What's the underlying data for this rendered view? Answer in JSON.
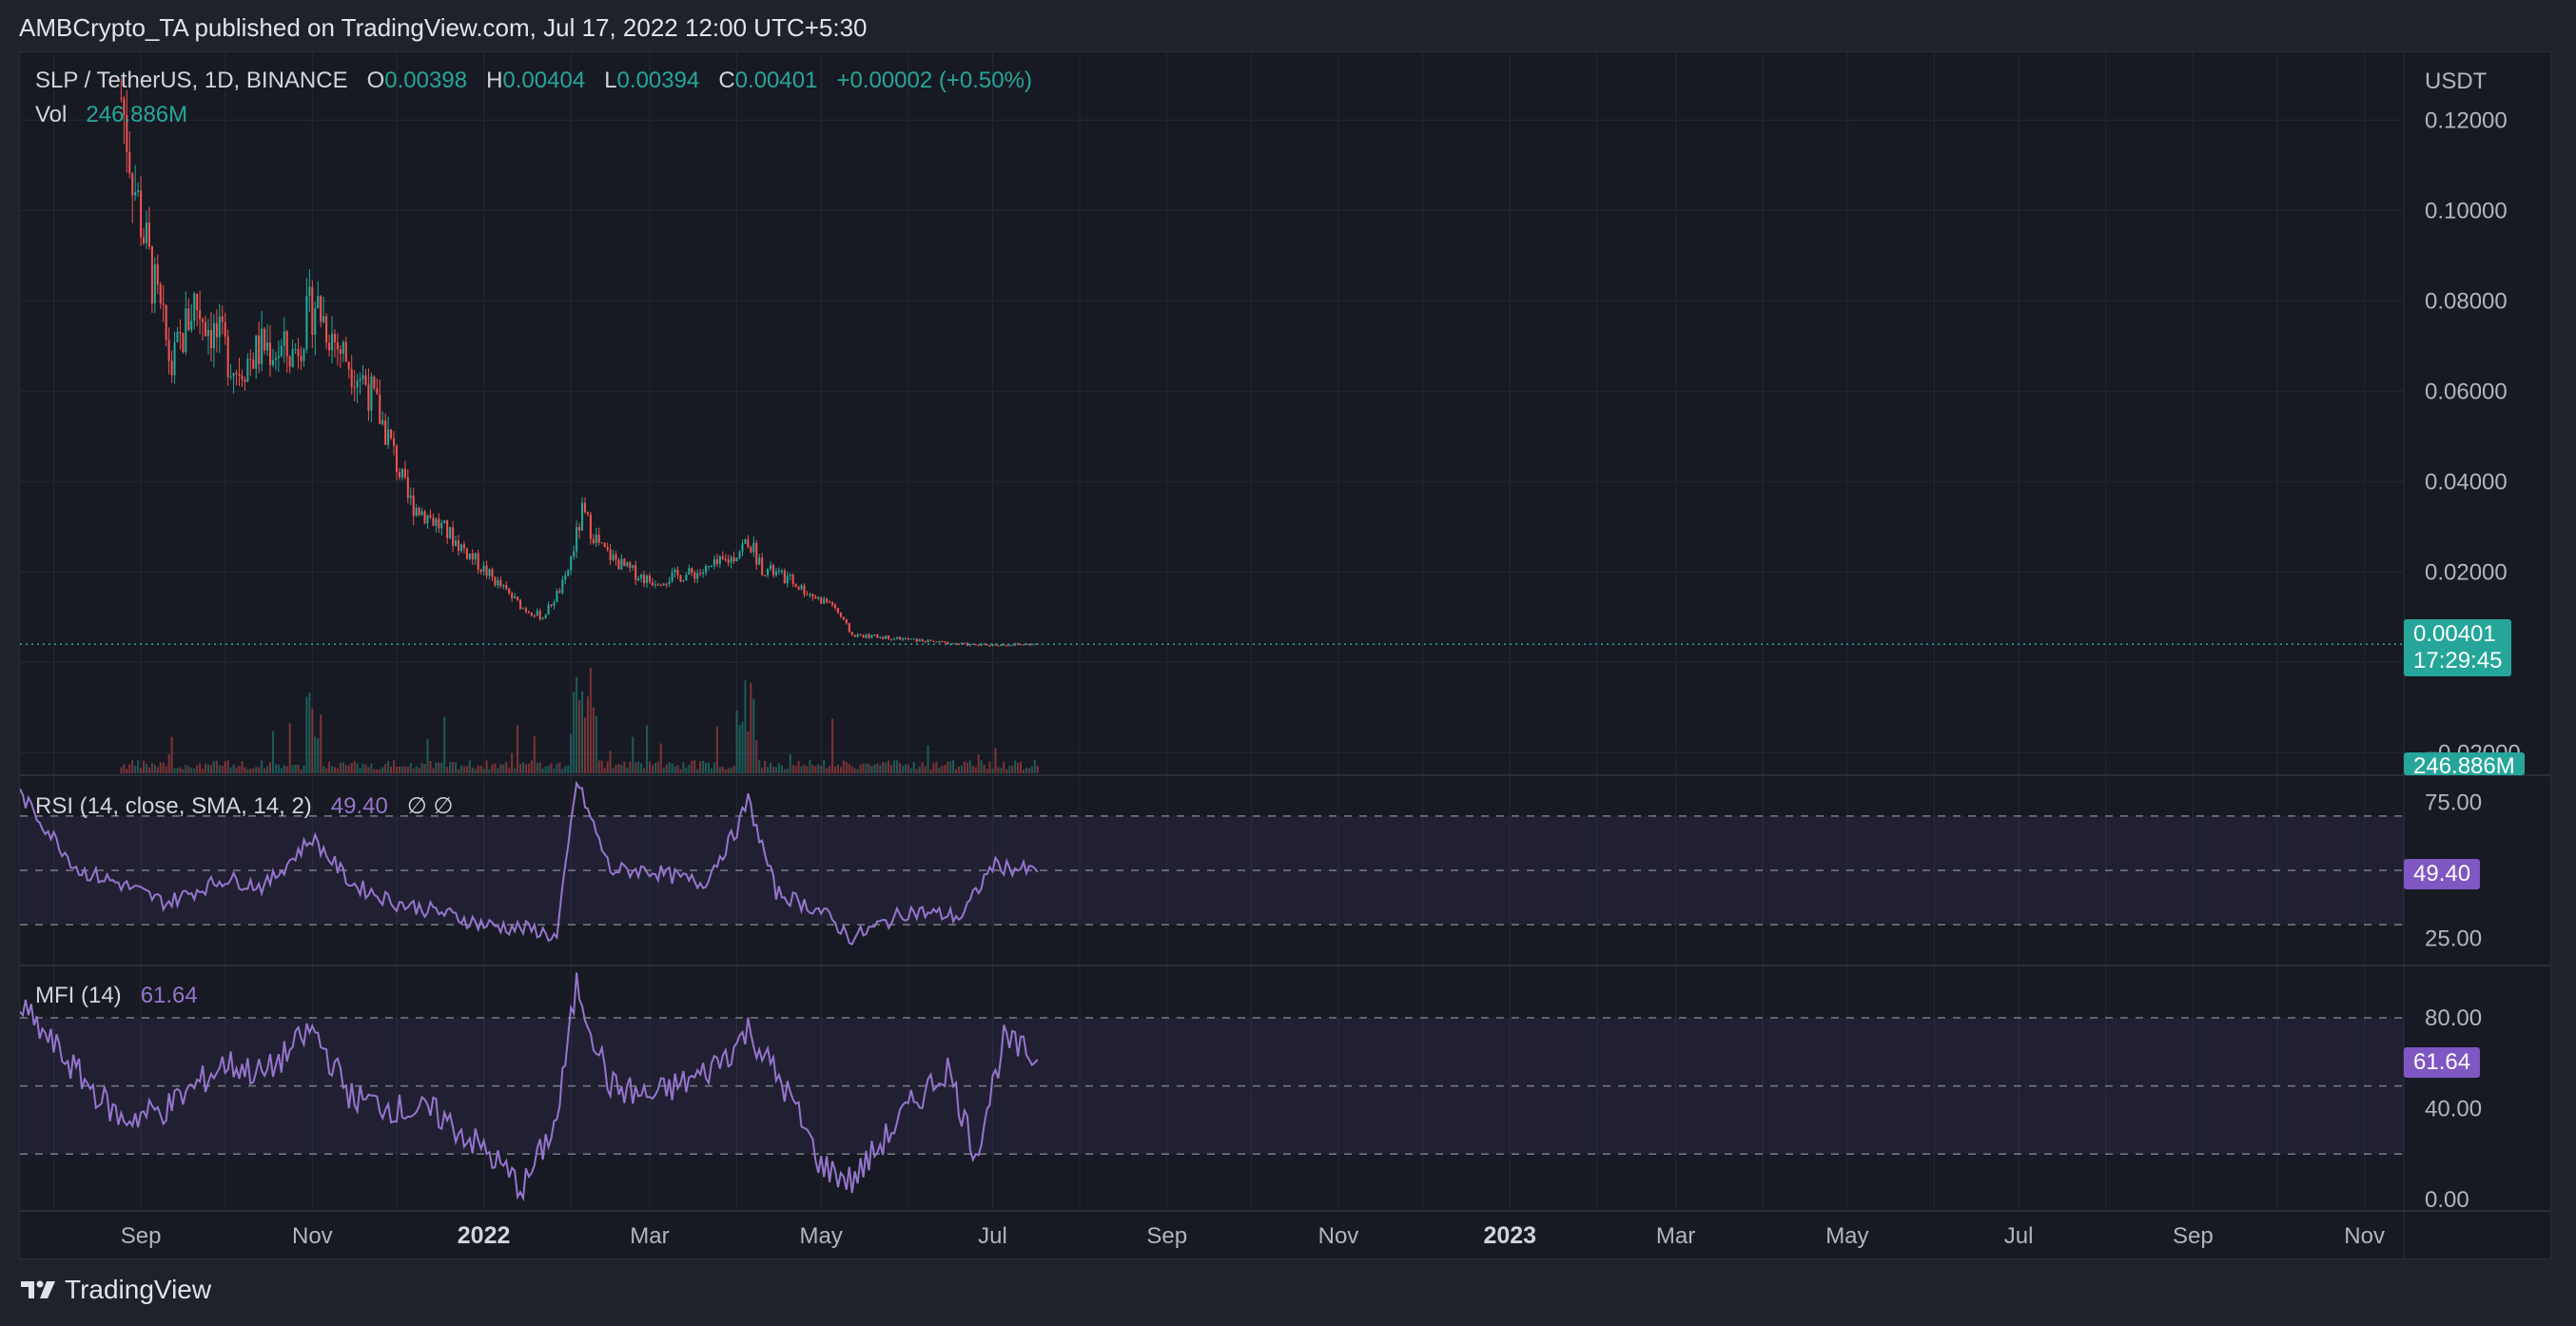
{
  "header": {
    "publisher_line": "AMBCrypto_TA published on TradingView.com, Jul 17, 2022 12:00 UTC+5:30"
  },
  "legend": {
    "symbol": "SLP / TetherUS, 1D, BINANCE",
    "o_label": "O",
    "o_value": "0.00398",
    "h_label": "H",
    "h_value": "0.00404",
    "l_label": "L",
    "l_value": "0.00394",
    "c_label": "C",
    "c_value": "0.00401",
    "change": "+0.00002 (+0.50%)",
    "vol_label": "Vol",
    "vol_value": "246.886M"
  },
  "price_axis": {
    "currency": "USDT",
    "ticks": [
      "0.12000",
      "0.10000",
      "0.08000",
      "0.06000",
      "0.04000",
      "0.02000",
      "−0.02000"
    ],
    "last_price": "0.00401",
    "countdown": "17:29:45",
    "volume_tag": "246.886M"
  },
  "rsi": {
    "label": "RSI (14, close, SMA, 14, 2)",
    "value": "49.40",
    "extra": "∅ ∅",
    "ticks": [
      "75.00",
      "25.00"
    ],
    "tag": "49.40"
  },
  "mfi": {
    "label": "MFI (14)",
    "value": "61.64",
    "ticks": [
      "80.00",
      "40.00",
      "0.00"
    ],
    "tag": "61.64"
  },
  "time_axis": [
    "Sep",
    "Nov",
    "2022",
    "Mar",
    "May",
    "Jul",
    "Sep",
    "Nov",
    "2023",
    "Mar",
    "May",
    "Jul",
    "Sep",
    "Nov"
  ],
  "footer": {
    "brand": "TradingView"
  },
  "colors": {
    "up": "#26a69a",
    "down": "#ef5350",
    "indicator": "#9575cd",
    "background": "#171a22"
  },
  "chart_data": [
    {
      "type": "candlestick",
      "title": "SLP / TetherUS, 1D, BINANCE",
      "y_unit": "USDT",
      "ylim": [
        -0.025,
        0.135
      ],
      "x_range": [
        "2021-07-20",
        "2023-11-15"
      ],
      "approx_close_series": [
        {
          "date": "2021-08-25",
          "close": 0.125
        },
        {
          "date": "2021-08-30",
          "close": 0.105
        },
        {
          "date": "2021-09-05",
          "close": 0.085
        },
        {
          "date": "2021-09-12",
          "close": 0.065
        },
        {
          "date": "2021-09-20",
          "close": 0.08
        },
        {
          "date": "2021-09-28",
          "close": 0.072
        },
        {
          "date": "2021-10-05",
          "close": 0.065
        },
        {
          "date": "2021-10-15",
          "close": 0.07
        },
        {
          "date": "2021-10-25",
          "close": 0.068
        },
        {
          "date": "2021-11-02",
          "close": 0.08
        },
        {
          "date": "2021-11-10",
          "close": 0.07
        },
        {
          "date": "2021-11-20",
          "close": 0.062
        },
        {
          "date": "2021-11-28",
          "close": 0.05
        },
        {
          "date": "2021-12-05",
          "close": 0.036
        },
        {
          "date": "2021-12-15",
          "close": 0.031
        },
        {
          "date": "2021-12-25",
          "close": 0.025
        },
        {
          "date": "2022-01-05",
          "close": 0.018
        },
        {
          "date": "2022-01-15",
          "close": 0.012
        },
        {
          "date": "2022-01-22",
          "close": 0.01
        },
        {
          "date": "2022-01-30",
          "close": 0.018
        },
        {
          "date": "2022-02-05",
          "close": 0.033
        },
        {
          "date": "2022-02-12",
          "close": 0.025
        },
        {
          "date": "2022-02-20",
          "close": 0.021
        },
        {
          "date": "2022-03-01",
          "close": 0.018
        },
        {
          "date": "2022-03-10",
          "close": 0.019
        },
        {
          "date": "2022-03-20",
          "close": 0.02
        },
        {
          "date": "2022-03-30",
          "close": 0.023
        },
        {
          "date": "2022-04-05",
          "close": 0.027
        },
        {
          "date": "2022-04-10",
          "close": 0.021
        },
        {
          "date": "2022-04-20",
          "close": 0.018
        },
        {
          "date": "2022-04-30",
          "close": 0.014
        },
        {
          "date": "2022-05-05",
          "close": 0.013
        },
        {
          "date": "2022-05-12",
          "close": 0.006
        },
        {
          "date": "2022-05-25",
          "close": 0.0055
        },
        {
          "date": "2022-06-10",
          "close": 0.0045
        },
        {
          "date": "2022-06-25",
          "close": 0.0038
        },
        {
          "date": "2022-07-17",
          "close": 0.00401
        }
      ],
      "last": {
        "open": 0.00398,
        "high": 0.00404,
        "low": 0.00394,
        "close": 0.00401,
        "change": 2e-05,
        "change_pct": 0.5
      },
      "volume_last": "246.886M"
    },
    {
      "type": "line",
      "title": "RSI (14, close, SMA, 14, 2)",
      "ylim": [
        15,
        85
      ],
      "bands": [
        30,
        50,
        70
      ],
      "last": 49.4,
      "approx_series": [
        {
          "date": "2021-07-20",
          "value": 78
        },
        {
          "date": "2021-08-10",
          "value": 50
        },
        {
          "date": "2021-08-25",
          "value": 45
        },
        {
          "date": "2021-09-10",
          "value": 38
        },
        {
          "date": "2021-10-01",
          "value": 47
        },
        {
          "date": "2021-10-15",
          "value": 44
        },
        {
          "date": "2021-11-01",
          "value": 62
        },
        {
          "date": "2021-11-15",
          "value": 45
        },
        {
          "date": "2021-12-01",
          "value": 38
        },
        {
          "date": "2021-12-15",
          "value": 35
        },
        {
          "date": "2022-01-01",
          "value": 30
        },
        {
          "date": "2022-01-20",
          "value": 28
        },
        {
          "date": "2022-01-27",
          "value": 25
        },
        {
          "date": "2022-02-03",
          "value": 83
        },
        {
          "date": "2022-02-15",
          "value": 50
        },
        {
          "date": "2022-03-01",
          "value": 50
        },
        {
          "date": "2022-03-20",
          "value": 45
        },
        {
          "date": "2022-04-01",
          "value": 65
        },
        {
          "date": "2022-04-05",
          "value": 76
        },
        {
          "date": "2022-04-15",
          "value": 42
        },
        {
          "date": "2022-05-01",
          "value": 35
        },
        {
          "date": "2022-05-12",
          "value": 25
        },
        {
          "date": "2022-06-01",
          "value": 35
        },
        {
          "date": "2022-06-20",
          "value": 33
        },
        {
          "date": "2022-07-01",
          "value": 52
        },
        {
          "date": "2022-07-17",
          "value": 49.4
        }
      ]
    },
    {
      "type": "line",
      "title": "MFI (14)",
      "ylim": [
        -5,
        103
      ],
      "bands": [
        20,
        50,
        80
      ],
      "last": 61.64,
      "approx_series": [
        {
          "date": "2021-07-20",
          "value": 85
        },
        {
          "date": "2021-08-10",
          "value": 55
        },
        {
          "date": "2021-08-25",
          "value": 35
        },
        {
          "date": "2021-09-10",
          "value": 40
        },
        {
          "date": "2021-10-01",
          "value": 60
        },
        {
          "date": "2021-10-15",
          "value": 55
        },
        {
          "date": "2021-11-01",
          "value": 75
        },
        {
          "date": "2021-11-15",
          "value": 45
        },
        {
          "date": "2021-12-01",
          "value": 40
        },
        {
          "date": "2021-12-15",
          "value": 38
        },
        {
          "date": "2022-01-01",
          "value": 22
        },
        {
          "date": "2022-01-15",
          "value": 5
        },
        {
          "date": "2022-01-27",
          "value": 35
        },
        {
          "date": "2022-02-03",
          "value": 95
        },
        {
          "date": "2022-02-15",
          "value": 50
        },
        {
          "date": "2022-03-01",
          "value": 45
        },
        {
          "date": "2022-03-20",
          "value": 55
        },
        {
          "date": "2022-04-01",
          "value": 68
        },
        {
          "date": "2022-04-05",
          "value": 75
        },
        {
          "date": "2022-04-20",
          "value": 45
        },
        {
          "date": "2022-05-01",
          "value": 15
        },
        {
          "date": "2022-05-12",
          "value": 8
        },
        {
          "date": "2022-06-01",
          "value": 40
        },
        {
          "date": "2022-06-15",
          "value": 58
        },
        {
          "date": "2022-06-25",
          "value": 20
        },
        {
          "date": "2022-07-05",
          "value": 70
        },
        {
          "date": "2022-07-17",
          "value": 61.64
        }
      ]
    }
  ]
}
